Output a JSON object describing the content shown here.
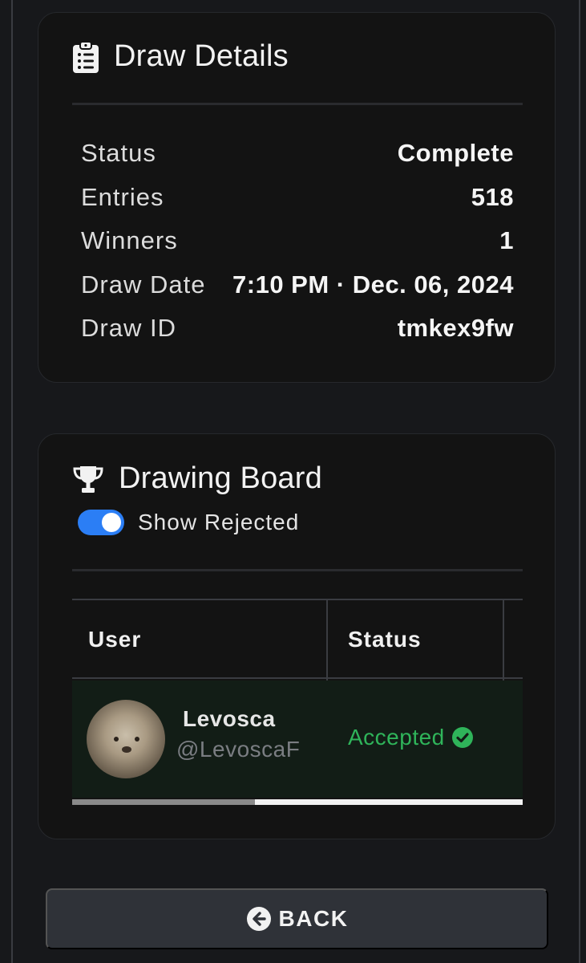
{
  "draw_details": {
    "title": "Draw Details",
    "icon": "clipboard-list-icon",
    "rows": [
      {
        "label": "Status",
        "value": "Complete"
      },
      {
        "label": "Entries",
        "value": "518"
      },
      {
        "label": "Winners",
        "value": "1"
      },
      {
        "label": "Draw Date",
        "value": "7:10 PM · Dec. 06, 2024"
      },
      {
        "label": "Draw ID",
        "value": "tmkex9fw"
      }
    ]
  },
  "drawing_board": {
    "title": "Drawing Board",
    "icon": "trophy-icon",
    "toggle": {
      "label": "Show Rejected",
      "on": true
    },
    "table": {
      "columns": [
        "User",
        "Status"
      ],
      "rows": [
        {
          "name": "Levosca",
          "handle": "@LevoscaF",
          "status": "Accepted",
          "status_icon": "check-circle-icon"
        }
      ]
    }
  },
  "back_button": {
    "label": "BACK",
    "icon": "arrow-circle-left-icon"
  },
  "colors": {
    "background": "#17181b",
    "card": "#131313",
    "accent_blue": "#2b7ef5",
    "accepted_green": "#2fb45a",
    "row_highlight": "#121d16",
    "button": "#2f3238"
  }
}
